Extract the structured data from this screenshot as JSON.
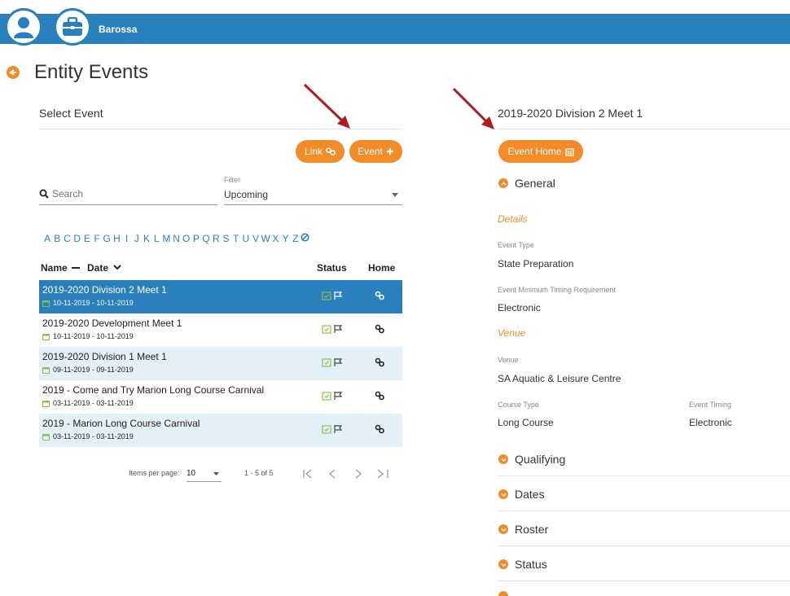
{
  "header": {
    "org_name": "Barossa"
  },
  "page": {
    "title": "Entity Events"
  },
  "left": {
    "section_title": "Select Event",
    "link_button": "Link",
    "event_button": "Event",
    "search": {
      "placeholder": "Search"
    },
    "filter": {
      "label": "Filter",
      "value": "Upcoming"
    },
    "alphabet": [
      "A",
      "B",
      "C",
      "D",
      "E",
      "F",
      "G",
      "H",
      "I",
      "J",
      "K",
      "L",
      "M",
      "N",
      "O",
      "P",
      "Q",
      "R",
      "S",
      "T",
      "U",
      "V",
      "W",
      "X",
      "Y",
      "Z"
    ],
    "table": {
      "col_name": "Name",
      "col_date": "Date",
      "col_status": "Status",
      "col_home": "Home",
      "rows": [
        {
          "name": "2019-2020 Division 2 Meet 1",
          "dates": "10-11-2019 - 10-11-2019",
          "selected": true
        },
        {
          "name": "2019-2020 Development Meet 1",
          "dates": "10-11-2019 - 10-11-2019",
          "selected": false
        },
        {
          "name": "2019-2020 Division 1 Meet 1",
          "dates": "09-11-2019 - 09-11-2019",
          "selected": false
        },
        {
          "name": "2019 - Come and Try Marion Long Course Carnival",
          "dates": "03-11-2019 - 03-11-2019",
          "selected": false
        },
        {
          "name": "2019 - Marion Long Course Carnival",
          "dates": "03-11-2019 - 03-11-2019",
          "selected": false
        }
      ]
    },
    "pager": {
      "items_label": "Items per page:",
      "per_page": "10",
      "range": "1 - 5 of 5"
    }
  },
  "right": {
    "event_title": "2019-2020 Division 2 Meet 1",
    "event_home_button": "Event Home",
    "general": "General",
    "details_heading": "Details",
    "event_type_label": "Event Type",
    "event_type_value": "State Preparation",
    "timing_req_label": "Event Minimum Timing Requirement",
    "timing_req_value": "Electronic",
    "venue_heading": "Venue",
    "venue_label": "Venue",
    "venue_value": "SA Aquatic & Leisure Centre",
    "course_type_label": "Course Type",
    "course_type_value": "Long Course",
    "event_timing_label": "Event Timing",
    "event_timing_value": "Electronic",
    "sections": [
      "Qualifying",
      "Dates",
      "Roster",
      "Status"
    ]
  },
  "colors": {
    "brand_blue": "#2a7fbd",
    "accent_orange": "#f28c28",
    "row_alt": "#e4f0f8",
    "annotation_red": "#b01c1c"
  }
}
